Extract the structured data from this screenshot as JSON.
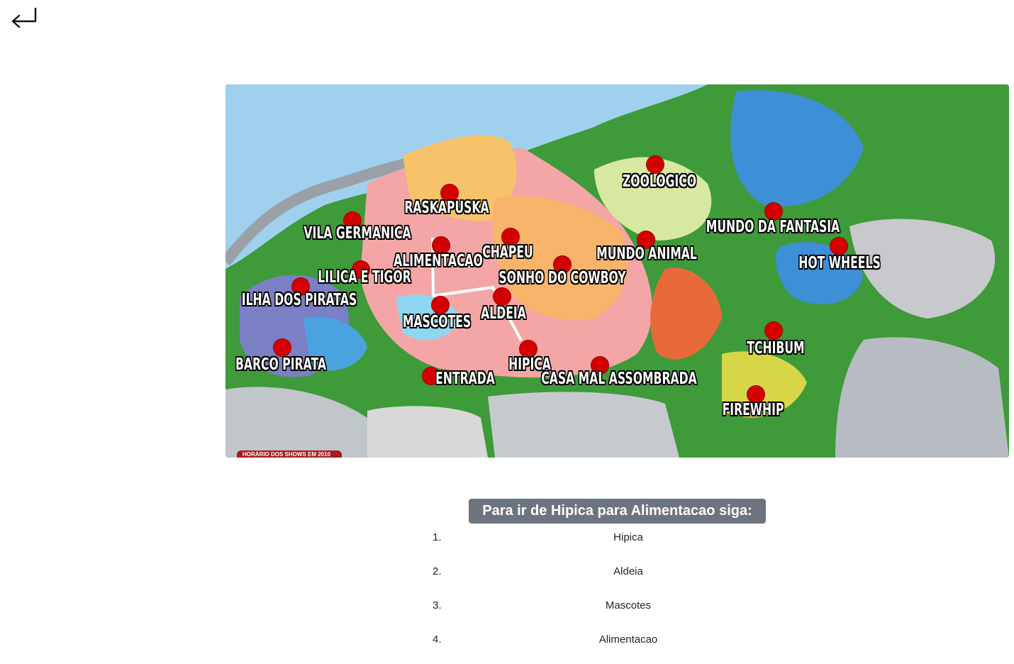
{
  "nav": {
    "back_icon": "return-arrow-icon"
  },
  "map": {
    "banner": "HORÁRIO DOS SHOWS EM 2010",
    "marker_color": "#d40000",
    "route_color": "#ffffff",
    "locations": [
      {
        "id": "zoologico",
        "label": "ZOOLOGICO"
      },
      {
        "id": "raskapuska",
        "label": "RASKAPUSKA"
      },
      {
        "id": "vila-germanica",
        "label": "VILA GERMANICA"
      },
      {
        "id": "mundo-da-fantasia",
        "label": "MUNDO DA FANTASIA"
      },
      {
        "id": "alimentacao",
        "label": "ALIMENTACAO"
      },
      {
        "id": "chapeu",
        "label": "CHAPEU"
      },
      {
        "id": "mundo-animal",
        "label": "MUNDO ANIMAL"
      },
      {
        "id": "hot-wheels",
        "label": "HOT WHEELS"
      },
      {
        "id": "sonho-do-cowboy",
        "label": "SONHO DO COWBOY"
      },
      {
        "id": "lilica-e-tigor",
        "label": "LILICA E TIGOR"
      },
      {
        "id": "ilha-dos-piratas",
        "label": "ILHA DOS PIRATAS"
      },
      {
        "id": "aldeia",
        "label": "ALDEIA"
      },
      {
        "id": "mascotes",
        "label": "MASCOTES"
      },
      {
        "id": "tchibum",
        "label": "TCHIBUM"
      },
      {
        "id": "hipica",
        "label": "HIPICA"
      },
      {
        "id": "barco-pirata",
        "label": "BARCO PIRATA"
      },
      {
        "id": "entrada",
        "label": "ENTRADA"
      },
      {
        "id": "casa-mal-assombrada",
        "label": "CASA MAL ASSOMBRADA"
      },
      {
        "id": "firewhip",
        "label": "FIREWHIP"
      }
    ]
  },
  "route": {
    "heading": "Para ir de Hipica para Alimentacao siga:",
    "steps": [
      {
        "num": "1.",
        "name": "Hipica"
      },
      {
        "num": "2.",
        "name": "Aldeia"
      },
      {
        "num": "3.",
        "name": "Mascotes"
      },
      {
        "num": "4.",
        "name": "Alimentacao"
      }
    ]
  }
}
